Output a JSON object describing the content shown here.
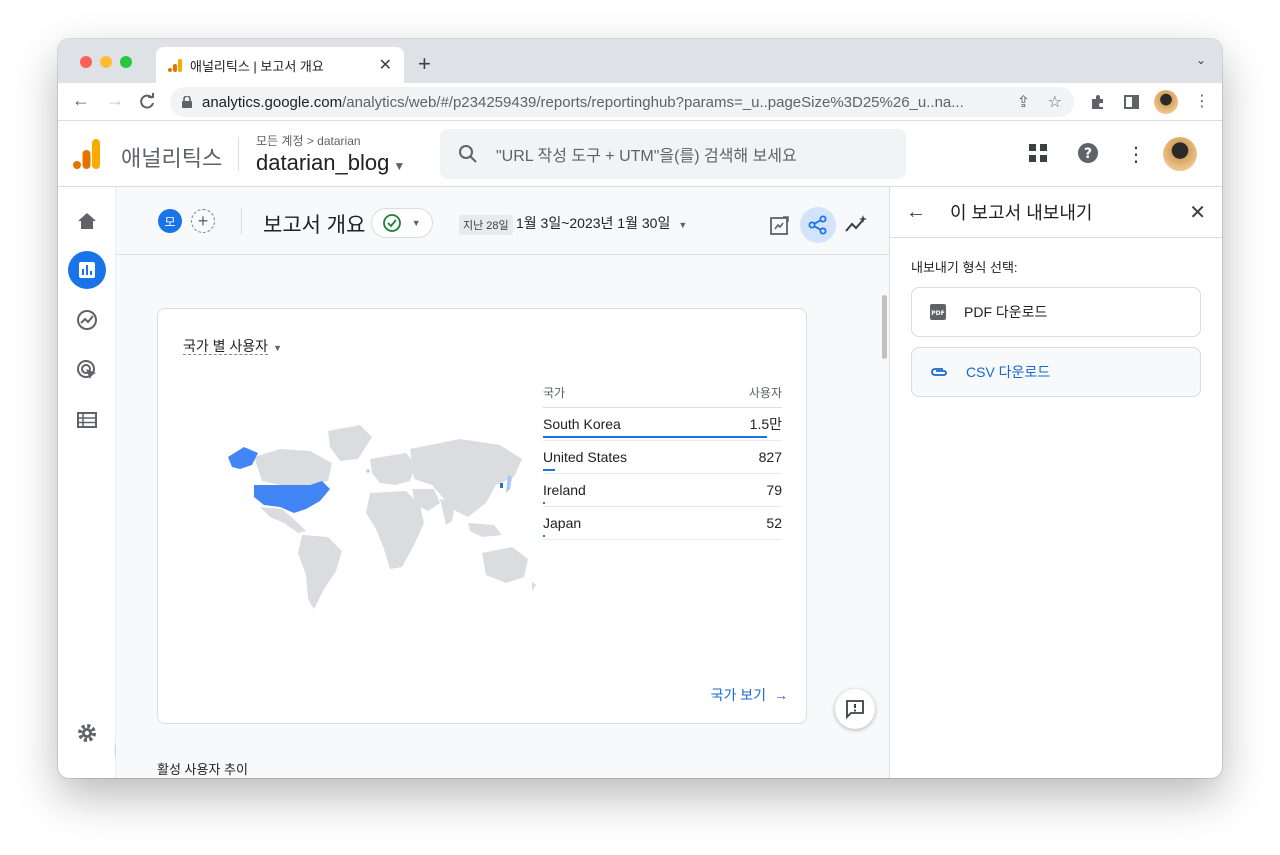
{
  "browser": {
    "tab_title": "애널리틱스 | 보고서 개요",
    "url_host": "analytics.google.com",
    "url_path": "/analytics/web/#/p234259439/reports/reportinghub?params=_u..pageSize%3D25%26_u..na..."
  },
  "ga": {
    "product_name": "애널리틱스",
    "account_crumb": "모든 계정 > datarian",
    "property_name": "datarian_blog",
    "search_placeholder": "\"URL 작성 도구 + UTM\"을(를) 검색해 보세요"
  },
  "report": {
    "chip_label": "모",
    "title": "보고서 개요",
    "date_badge": "지난 28일",
    "date_range": "1월 3일~2023년 1월 30일"
  },
  "card": {
    "title": "국가 별 사용자",
    "col_country": "국가",
    "col_users": "사용자",
    "rows": [
      {
        "country": "South Korea",
        "users": "1.5만",
        "share": 1.0
      },
      {
        "country": "United States",
        "users": "827",
        "share": 0.055
      },
      {
        "country": "Ireland",
        "users": "79",
        "share": 0.005
      },
      {
        "country": "Japan",
        "users": "52",
        "share": 0.004
      }
    ],
    "link": "국가 보기"
  },
  "next_section": "활성 사용자 추이",
  "panel": {
    "title": "이 보고서 내보내기",
    "format_label": "내보내기 형식 선택:",
    "pdf_label": "PDF 다운로드",
    "csv_label": "CSV 다운로드"
  },
  "colors": {
    "accent": "#1a73e8",
    "logo_orange": "#f9ab00",
    "logo_dark_orange": "#e37400"
  }
}
